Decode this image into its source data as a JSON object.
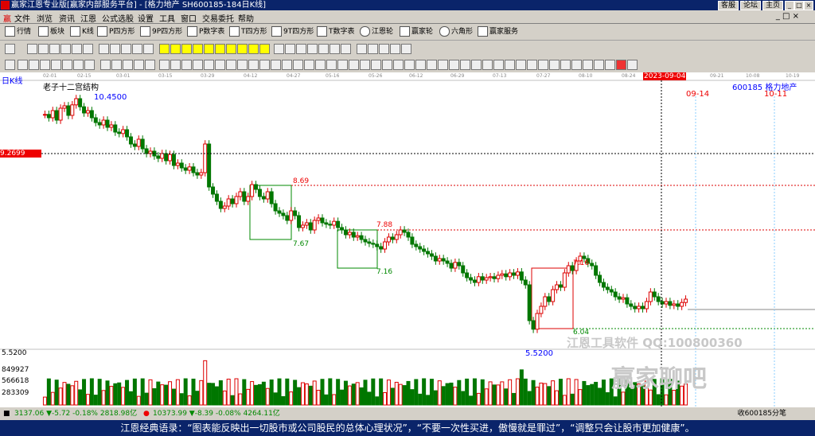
{
  "window": {
    "title": "赢家江恩专业版[赢家内部服务平台] - [格力地产  SH600185-184日K线]",
    "links": [
      "客服",
      "论坛",
      "主页"
    ]
  },
  "menu": [
    "文件",
    "浏览",
    "资讯",
    "江恩",
    "公式选股",
    "设置",
    "工具",
    "窗口",
    "交易委托",
    "帮助"
  ],
  "toolbar1": [
    "行情",
    "板块",
    "K线",
    "P四方形",
    "9P四方形",
    "P数字表",
    "T四方形",
    "9T四方形",
    "T数字表",
    "江恩轮",
    "赢家轮",
    "六角形",
    "赢家服务"
  ],
  "chart": {
    "period_label": "日K线",
    "indicator_title": "老子十二宫结构",
    "stock_label": "600185  格力地产",
    "price_high_label": "10.4500",
    "price_low_label": "5.5200",
    "crosshair_price": "9.2699",
    "crosshair_date": "2023-09-04",
    "future_dates": [
      "09-14",
      "10-11"
    ],
    "box_levels": [
      "8.69",
      "7.67",
      "7.88",
      "7.16",
      "7.16",
      "6.04"
    ],
    "volume_labels": [
      "5.5200",
      "849927",
      "566618",
      "283309"
    ],
    "xaxis_dates": [
      "02-01",
      "02-15",
      "03-01",
      "03-15",
      "03-29",
      "04-12",
      "04-27",
      "05-16",
      "05-26",
      "06-12",
      "06-29",
      "07-13",
      "07-27",
      "08-10",
      "08-24",
      "09-21",
      "10-08",
      "10-19"
    ],
    "watermark_software": "江恩工具软件  QQ:100800360",
    "watermark_brand": "赢家聊吧"
  },
  "chart_data": {
    "type": "candlestick",
    "title": "老子十二宫结构",
    "closes": [
      10.12,
      10.05,
      10.2,
      10.0,
      10.25,
      10.3,
      10.1,
      10.32,
      10.45,
      10.28,
      10.15,
      10.2,
      10.05,
      9.95,
      9.9,
      10.0,
      9.85,
      9.9,
      9.75,
      9.72,
      9.8,
      9.65,
      9.5,
      9.45,
      9.6,
      9.4,
      9.3,
      9.35,
      9.25,
      9.2,
      9.3,
      9.15,
      9.28,
      9.05,
      9.1,
      9.0,
      8.95,
      9.02,
      8.9,
      8.85,
      8.9,
      9.5,
      8.6,
      8.45,
      8.3,
      8.15,
      8.2,
      8.35,
      8.25,
      8.4,
      8.5,
      8.3,
      8.4,
      8.65,
      8.55,
      8.4,
      8.35,
      8.5,
      8.25,
      8.1,
      8.05,
      8.0,
      7.9,
      8.1,
      8.0,
      7.75,
      7.8,
      7.85,
      7.7,
      7.9,
      7.95,
      7.85,
      7.82,
      7.8,
      7.88,
      7.75,
      7.7,
      7.6,
      7.65,
      7.55,
      7.58,
      7.5,
      7.45,
      7.42,
      7.4,
      7.35,
      7.3,
      7.45,
      7.55,
      7.5,
      7.6,
      7.7,
      7.65,
      7.55,
      7.4,
      7.35,
      7.3,
      7.25,
      7.2,
      7.15,
      7.05,
      7.1,
      7.05,
      7.0,
      6.9,
      7.02,
      6.95,
      6.8,
      6.7,
      6.65,
      6.6,
      6.72,
      6.65,
      6.7,
      6.72,
      6.68,
      6.75,
      6.78,
      6.72,
      6.8,
      6.75,
      6.82,
      6.65,
      6.55,
      5.8,
      5.62,
      5.95,
      6.1,
      6.3,
      6.2,
      6.45,
      6.55,
      6.5,
      6.8,
      6.95,
      6.85,
      7.05,
      7.15,
      7.1,
      7.0,
      6.95,
      6.75,
      6.6,
      6.5,
      6.45,
      6.4,
      6.3,
      6.25,
      6.28,
      6.15,
      6.1,
      6.05,
      6.1,
      6.05,
      6.2,
      6.4,
      6.3,
      6.2,
      6.15,
      6.2,
      6.12,
      6.15,
      6.1,
      6.18,
      6.25
    ],
    "ylim": [
      5.3,
      10.6
    ],
    "volume_ylim": [
      0,
      849927
    ]
  }
}
